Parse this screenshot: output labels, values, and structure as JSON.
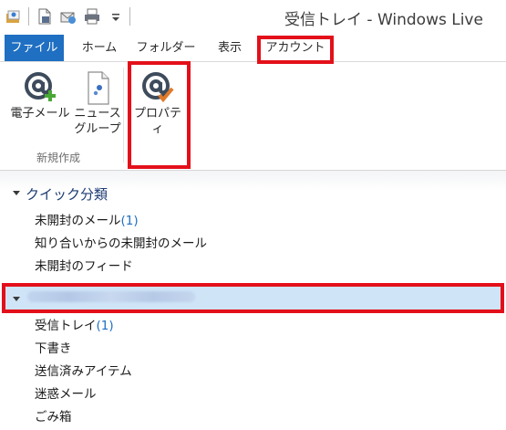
{
  "window": {
    "title": "受信トレイ - Windows Live"
  },
  "quick_access": {
    "icons": [
      "app-icon",
      "new-document-icon",
      "send-receive-icon",
      "print-icon",
      "dropdown-icon"
    ]
  },
  "menu": {
    "tabs": [
      "ファイル",
      "ホーム",
      "フォルダー",
      "表示",
      "アカウント"
    ]
  },
  "ribbon": {
    "buttons": [
      {
        "label_line1": "電子メール",
        "label_line2": "",
        "icon": "email-add-icon"
      },
      {
        "label_line1": "ニュース",
        "label_line2": "グループ",
        "icon": "newsgroup-icon"
      },
      {
        "label_line1": "プロパティ",
        "label_line2": "",
        "icon": "properties-icon"
      }
    ],
    "group_label": "新規作成"
  },
  "folders": {
    "quick_views": {
      "header": "クイック分類",
      "items": [
        {
          "label": "未開封のメール",
          "count": "(1)"
        },
        {
          "label": "知り合いからの未開封のメール",
          "count": ""
        },
        {
          "label": "未開封のフィード",
          "count": ""
        }
      ]
    },
    "account": {
      "items": [
        {
          "label": "受信トレイ",
          "count": "(1)"
        },
        {
          "label": "下書き",
          "count": ""
        },
        {
          "label": "送信済みアイテム",
          "count": ""
        },
        {
          "label": "迷惑メール",
          "count": ""
        },
        {
          "label": "ごみ箱",
          "count": ""
        }
      ]
    }
  },
  "colors": {
    "accent": "#1f6fc2",
    "highlight": "#e3101a",
    "selected_row": "#cfe4f7"
  }
}
